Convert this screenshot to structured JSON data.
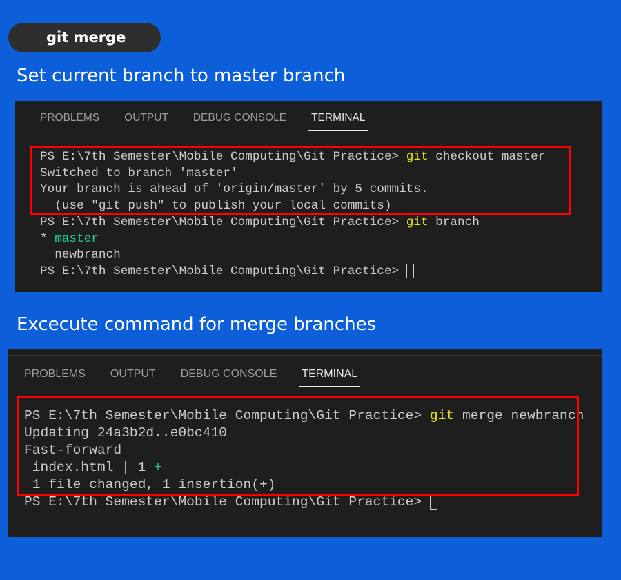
{
  "badge": {
    "label": "git merge"
  },
  "section1": {
    "heading": "Set current branch to master branch",
    "tabs": [
      "PROBLEMS",
      "OUTPUT",
      "DEBUG CONSOLE",
      "TERMINAL"
    ],
    "active_tab": "TERMINAL",
    "lines": [
      [
        {
          "t": "PS E:\\7th Semester\\Mobile Computing\\Git Practice> ",
          "c": "#cccccc"
        },
        {
          "t": "git",
          "c": "#e5e510"
        },
        {
          "t": " checkout master",
          "c": "#cccccc"
        }
      ],
      [
        {
          "t": "Switched to branch 'master'",
          "c": "#cccccc"
        }
      ],
      [
        {
          "t": "Your branch is ahead of 'origin/master' by 5 commits.",
          "c": "#cccccc"
        }
      ],
      [
        {
          "t": "  (use \"git push\" to publish your local commits)",
          "c": "#cccccc"
        }
      ],
      [
        {
          "t": "PS E:\\7th Semester\\Mobile Computing\\Git Practice> ",
          "c": "#cccccc"
        },
        {
          "t": "git",
          "c": "#e5e510"
        },
        {
          "t": " branch",
          "c": "#cccccc"
        }
      ],
      [
        {
          "t": "* ",
          "c": "#cccccc"
        },
        {
          "t": "master",
          "c": "#23d18b"
        }
      ],
      [
        {
          "t": "  newbranch",
          "c": "#cccccc"
        }
      ],
      [
        {
          "t": "PS E:\\7th Semester\\Mobile Computing\\Git Practice> ",
          "c": "#cccccc"
        }
      ]
    ]
  },
  "section2": {
    "heading": "Excecute command for merge branches",
    "tabs": [
      "PROBLEMS",
      "OUTPUT",
      "DEBUG CONSOLE",
      "TERMINAL"
    ],
    "active_tab": "TERMINAL",
    "lines": [
      [
        {
          "t": "PS E:\\7th Semester\\Mobile Computing\\Git Practice> ",
          "c": "#cccccc"
        },
        {
          "t": "git",
          "c": "#e5e510"
        },
        {
          "t": " merge newbranch",
          "c": "#cccccc"
        }
      ],
      [
        {
          "t": "Updating 24a3b2d..e0bc410",
          "c": "#cccccc"
        }
      ],
      [
        {
          "t": "Fast-forward",
          "c": "#cccccc"
        }
      ],
      [
        {
          "t": " index.html | 1 ",
          "c": "#cccccc"
        },
        {
          "t": "+",
          "c": "#23d18b"
        }
      ],
      [
        {
          "t": " 1 file changed, 1 insertion(+)",
          "c": "#cccccc"
        }
      ],
      [
        {
          "t": "PS E:\\7th Semester\\Mobile Computing\\Git Practice> ",
          "c": "#cccccc"
        }
      ]
    ]
  },
  "colors": {
    "background": "#0c5fd8",
    "terminal_bg": "#1e1e1e",
    "highlight_box": "#ff0000",
    "git_keyword": "#e5e510",
    "branch_green": "#23d18b"
  }
}
